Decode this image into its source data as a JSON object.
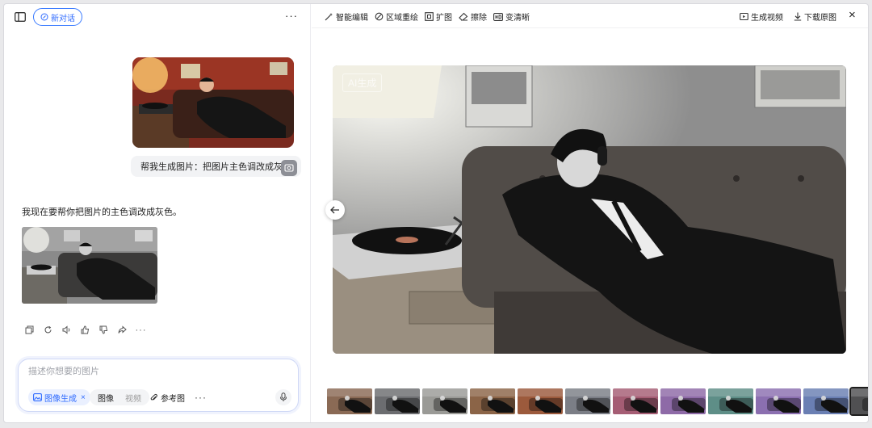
{
  "left": {
    "new_chat_label": "新对话",
    "user_message": "帮我生成图片：把图片主色调改成灰色",
    "assistant_message": "我现在要帮你把图片的主色调改成灰色。",
    "composer": {
      "placeholder": "描述你想要的图片",
      "mode_chip": "图像生成",
      "mode_chip_close": "×",
      "seg_image": "图像",
      "seg_video": "视频",
      "reference_label": "参考图",
      "more": "···"
    },
    "more_menu": "···"
  },
  "toolbar": {
    "smart_edit": "智能编辑",
    "region_redraw": "区域重绘",
    "expand": "扩图",
    "erase": "擦除",
    "sharpen": "变清晰",
    "generate_video": "生成视频",
    "download": "下载原图",
    "close": "×"
  },
  "viewer": {
    "watermark": "AI生成"
  },
  "thumbnails": [
    {
      "tone": "#8a6a55",
      "selected": false
    },
    {
      "tone": "#6c6d70",
      "selected": false
    },
    {
      "tone": "#9a9a96",
      "selected": false
    },
    {
      "tone": "#8b6447",
      "selected": false
    },
    {
      "tone": "#9c5a3c",
      "selected": false
    },
    {
      "tone": "#7b7e86",
      "selected": false
    },
    {
      "tone": "#a55d74",
      "selected": false
    },
    {
      "tone": "#8e6aa7",
      "selected": false
    },
    {
      "tone": "#5e8e87",
      "selected": false
    },
    {
      "tone": "#8b6fb0",
      "selected": false
    },
    {
      "tone": "#6a7fb3",
      "selected": false
    },
    {
      "tone": "#505052",
      "selected": true
    }
  ],
  "colors": {
    "accent": "#2f6bff",
    "border": "#ececf0"
  }
}
